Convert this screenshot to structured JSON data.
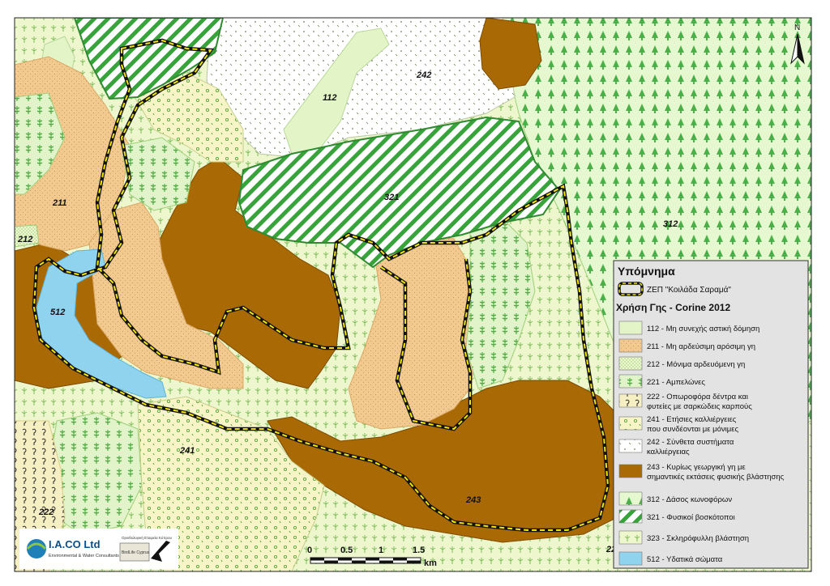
{
  "map": {
    "labels": {
      "z112": "112",
      "z211": "211",
      "z212": "212",
      "z222": "222",
      "z241": "241",
      "z242": "242",
      "z243": "243",
      "z312": "312",
      "z321": "321",
      "z512": "512",
      "z22x": "22"
    },
    "north_label": "N",
    "colors": {
      "urban": "#e3f5c6",
      "arable": "#f2c98f",
      "irrigated": "#eef7cf",
      "vine": "#e1f3c9",
      "fruit": "#f7efc4",
      "annual": "#f7f4c8",
      "complex": "#ffffff",
      "agri_natural": "#a96a06",
      "conifer": "#e6f8cf",
      "pasture": "#37a33a",
      "sclero": "#eef6ce",
      "water": "#8fd3ee",
      "boundary": "#f2e600"
    }
  },
  "legend": {
    "title": "Υπόμνημα",
    "boundary_label": "ΖΕΠ \"Κοιλάδα Σαραμά\"",
    "section_title": "Χρήση Γης - Corine 2012",
    "items": [
      {
        "lines": [
          "112 - Μη συνεχής αστική δόμηση"
        ],
        "pattern": "urban"
      },
      {
        "lines": [
          "211 - Μη αρδεύσιμη αρόσιμη γη"
        ],
        "pattern": "arable"
      },
      {
        "lines": [
          "212 - Μόνιμα αρδευόμενη γη"
        ],
        "pattern": "irrigated"
      },
      {
        "lines": [
          "221 - Αμπελώνες"
        ],
        "pattern": "vine"
      },
      {
        "lines": [
          "222 - Οπωροφόρα δέντρα και",
          "φυτείες με σαρκώδεις καρπούς"
        ],
        "pattern": "fruit"
      },
      {
        "lines": [
          "241 - Ετήσιες καλλιέργειες",
          "που συνδέονται με μόνιμες"
        ],
        "pattern": "annual"
      },
      {
        "lines": [
          "242 - Σύνθετα συστήματα",
          "καλλιέργειας"
        ],
        "pattern": "complex"
      },
      {
        "lines": [
          "243 - Κυρίως γεωργική γη με",
          "σημαντικές εκτάσεις φυσικής βλάστησης"
        ],
        "pattern": "agri_natural"
      },
      {
        "lines": [
          "312 - Δάσος κωνοφόρων"
        ],
        "pattern": "conifer"
      },
      {
        "lines": [
          "321 - Φυσικοί βοσκότοποι"
        ],
        "pattern": "pasture"
      },
      {
        "lines": [
          "323 - Σκληρόφυλλη βλάστηση"
        ],
        "pattern": "sclero"
      },
      {
        "lines": [
          "512 - Υδατικά σώματα"
        ],
        "pattern": "water"
      }
    ]
  },
  "scalebar": {
    "ticks": [
      "0",
      "0.5",
      "1",
      "1.5"
    ],
    "unit": "km"
  },
  "logos": {
    "company_main": "I.A.CO Ltd",
    "company_sub": "Environmental & Water Consultants",
    "partner_top": "Ορνιθολογική Εταιρεία Κύπρου",
    "partner_name": "BirdLife Cyprus"
  }
}
